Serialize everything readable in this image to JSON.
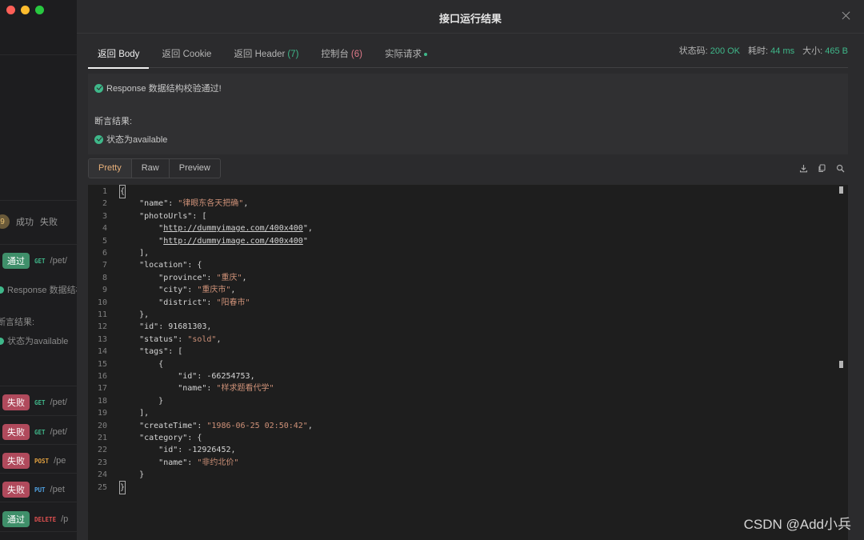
{
  "left_panel": {
    "filter": {
      "badge": "9",
      "success": "成功",
      "fail": "失败"
    },
    "rows": [
      {
        "status": "通过",
        "kind": "pass",
        "method": "GET",
        "path": "/pet/"
      },
      {
        "status": "失败",
        "kind": "fail",
        "method": "GET",
        "path": "/pet/"
      },
      {
        "status": "失败",
        "kind": "fail",
        "method": "GET",
        "path": "/pet/"
      },
      {
        "status": "失败",
        "kind": "fail",
        "method": "POST",
        "path": "/pe"
      },
      {
        "status": "失败",
        "kind": "fail",
        "method": "PUT",
        "path": "/pet"
      },
      {
        "status": "通过",
        "kind": "pass",
        "method": "DELETE",
        "path": "/p"
      }
    ],
    "validation_text": "Response 数据结构",
    "assert_title": "断言结果:",
    "assert_item": "状态为available"
  },
  "modal": {
    "title": "接口运行结果",
    "tabs": [
      {
        "label": "返回 Body",
        "count": ""
      },
      {
        "label": "返回 Cookie",
        "count": ""
      },
      {
        "label": "返回 Header",
        "count": "(7)"
      },
      {
        "label": "控制台",
        "count": "(6)"
      },
      {
        "label": "实际请求",
        "count": ""
      }
    ],
    "stats": {
      "status_label": "状态码:",
      "status_value": "200 OK",
      "time_label": "耗时:",
      "time_value": "44 ms",
      "size_label": "大小:",
      "size_value": "465 B"
    },
    "validation": "Response 数据结构校验通过!",
    "assert_title": "断言结果:",
    "assert_item": "状态为available",
    "view_modes": [
      "Pretty",
      "Raw",
      "Preview"
    ],
    "active_view": "Pretty",
    "tool_icons": [
      "download-icon",
      "copy-icon",
      "search-icon"
    ]
  },
  "code_lines": [
    "{",
    "    \"name\": \"律眼东各天把确\",",
    "    \"photoUrls\": [",
    "        \"http://dummyimage.com/400x400\",",
    "        \"http://dummyimage.com/400x400\"",
    "    ],",
    "    \"location\": {",
    "        \"province\": \"重庆\",",
    "        \"city\": \"重庆市\",",
    "        \"district\": \"阳春市\"",
    "    },",
    "    \"id\": 91681303,",
    "    \"status\": \"sold\",",
    "    \"tags\": [",
    "        {",
    "            \"id\": -66254753,",
    "            \"name\": \"样求题看代学\"",
    "        }",
    "    ],",
    "    \"createTime\": \"1986-06-25 02:50:42\",",
    "    \"category\": {",
    "        \"id\": -12926452,",
    "        \"name\": \"非约北价\"",
    "    }",
    "}"
  ],
  "watermark": "CSDN @Add小兵",
  "colors": {
    "success": "#3fb88a",
    "fail": "#b04a5c",
    "accent": "#e7b07a",
    "string": "#ce9178"
  }
}
